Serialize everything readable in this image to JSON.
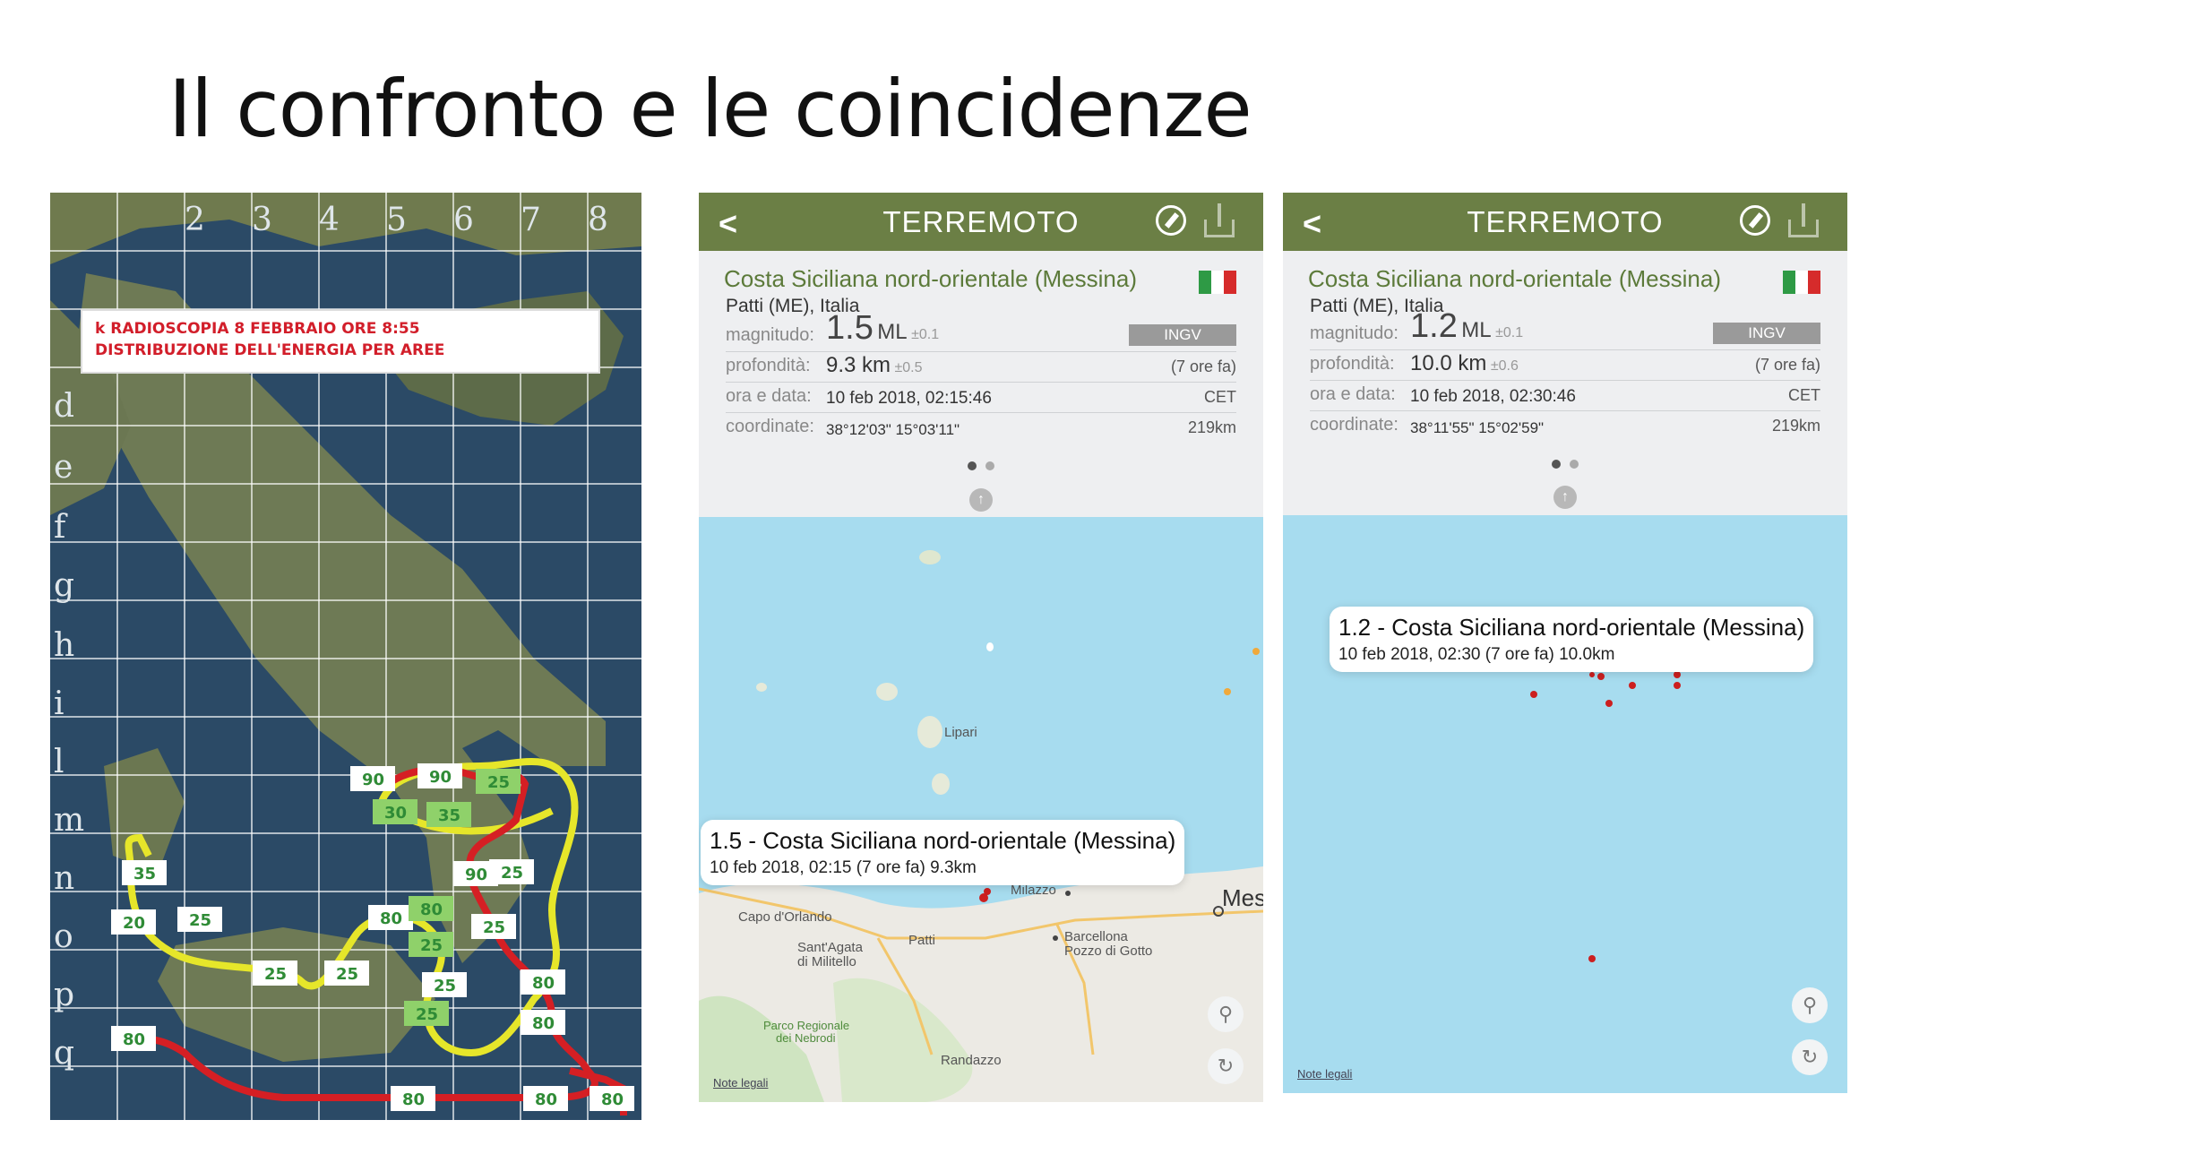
{
  "slide": {
    "title": "Il confronto e le coincidenze"
  },
  "left_map": {
    "column_labels": [
      "2",
      "3",
      "4",
      "5",
      "6",
      "7",
      "8"
    ],
    "row_labels": [
      "d",
      "e",
      "f",
      "g",
      "h",
      "i",
      "l",
      "m",
      "n",
      "o",
      "p",
      "q"
    ],
    "caption_line1": "k RADIOSCOPIA 8 FEBBRAIO ORE 8:55",
    "caption_line2": "DISTRIBUZIONE DELL'ENERGIA PER AREE",
    "values": [
      "90",
      "90",
      "25",
      "30",
      "35",
      "35",
      "90",
      "25",
      "20",
      "25",
      "80",
      "80",
      "25",
      "25",
      "25",
      "25",
      "25",
      "80",
      "25",
      "80",
      "80",
      "80",
      "80",
      "80"
    ]
  },
  "phones": [
    {
      "nav_title": "TERREMOTO",
      "place": "Costa Siciliana nord-orientale (Messina)",
      "sub": "Patti (ME), Italia",
      "magnitude_label": "magnitudo:",
      "magnitude": "1.5",
      "magnitude_unit": "ML",
      "magnitude_tol": "±0.1",
      "agency": "INGV",
      "depth_label": "profondità:",
      "depth": "9.3 km",
      "depth_tol": "±0.5",
      "ago": "(7 ore fa)",
      "datetime_label": "ora e data:",
      "datetime": "10 feb 2018, 02:15:46",
      "tz": "CET",
      "coord_label": "coordinate:",
      "coords": "38°12'03\"  15°03'11\"",
      "distance": "219km",
      "callout_title": "1.5 - Costa Siciliana nord-orientale (Messina)",
      "callout_sub": "10 feb 2018, 02:15 (7 ore fa) 9.3km",
      "note": "Note legali",
      "map_labels": {
        "lipari": "Lipari",
        "milazzo": "Milazzo",
        "capo": "Capo d'Orlando",
        "patti": "Patti",
        "santagata": "Sant'Agata",
        "militello": "di Militello",
        "barcellona": "Barcellona",
        "pozzo": "Pozzo di Gotto",
        "parco": "Parco Regionale",
        "nebrodi": "dei Nebrodi",
        "randazzo": "Randazzo",
        "messina": "Mes"
      }
    },
    {
      "nav_title": "TERREMOTO",
      "place": "Costa Siciliana nord-orientale (Messina)",
      "sub": "Patti (ME), Italia",
      "magnitude_label": "magnitudo:",
      "magnitude": "1.2",
      "magnitude_unit": "ML",
      "magnitude_tol": "±0.1",
      "agency": "INGV",
      "depth_label": "profondità:",
      "depth": "10.0 km",
      "depth_tol": "±0.6",
      "ago": "(7 ore fa)",
      "datetime_label": "ora e data:",
      "datetime": "10 feb 2018, 02:30:46",
      "tz": "CET",
      "coord_label": "coordinate:",
      "coords": "38°11'55\"  15°02'59\"",
      "distance": "219km",
      "callout_title": "1.2 - Costa Siciliana nord-orientale (Messina)",
      "callout_sub": "10 feb 2018, 02:30 (7 ore fa) 10.0km",
      "note": "Note legali"
    }
  ],
  "colors": {
    "nav": "#6b7f45",
    "place": "#5c7a3a",
    "sea": "#a7dcef",
    "quake": "#cc1f1f"
  }
}
